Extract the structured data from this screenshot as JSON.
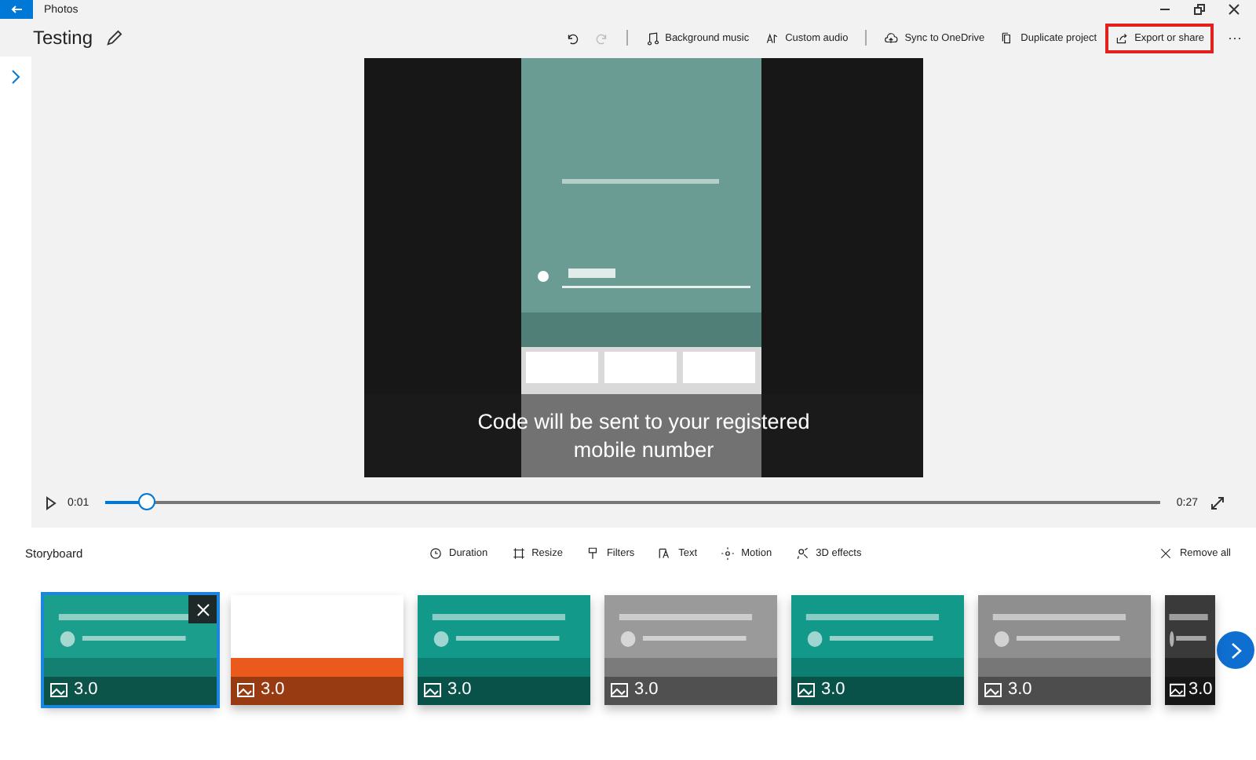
{
  "window": {
    "title": "Photos"
  },
  "project": {
    "title": "Testing"
  },
  "toolbar": [
    {
      "kind": "undo",
      "disabled": false,
      "highlighted": false
    },
    {
      "kind": "redo",
      "disabled": true,
      "highlighted": false
    },
    {
      "kind": "music",
      "label": "Background music",
      "disabled": false,
      "highlighted": false
    },
    {
      "kind": "audio",
      "label": "Custom audio",
      "disabled": false,
      "highlighted": false
    },
    {
      "kind": "cloud",
      "label": "Sync to OneDrive",
      "disabled": false,
      "highlighted": false
    },
    {
      "kind": "copy",
      "label": "Duplicate project",
      "disabled": false,
      "highlighted": false
    },
    {
      "kind": "share",
      "label": "Export or share",
      "disabled": false,
      "highlighted": true
    }
  ],
  "more": "···",
  "preview": {
    "caption": "Code will be sent to your registered mobile number"
  },
  "playback": {
    "elapsed": "0:01",
    "total": "0:27",
    "level": 0.04
  },
  "storyboard": {
    "title": "Storyboard",
    "tools": [
      {
        "kind": "duration",
        "label": "Duration"
      },
      {
        "kind": "resize",
        "label": "Resize"
      },
      {
        "kind": "filters",
        "label": "Filters"
      },
      {
        "kind": "text",
        "label": "Text"
      },
      {
        "kind": "motion",
        "label": "Motion"
      },
      {
        "kind": "effects",
        "label": "3D effects"
      }
    ],
    "remove_all": "Remove all"
  },
  "clips": [
    {
      "duration": "3.0",
      "selected": true
    },
    {
      "duration": "3.0",
      "selected": false
    },
    {
      "duration": "3.0",
      "selected": false
    },
    {
      "duration": "3.0",
      "selected": false
    },
    {
      "duration": "3.0",
      "selected": false
    },
    {
      "duration": "3.0",
      "selected": false
    },
    {
      "duration": "3.0",
      "selected": false
    }
  ]
}
